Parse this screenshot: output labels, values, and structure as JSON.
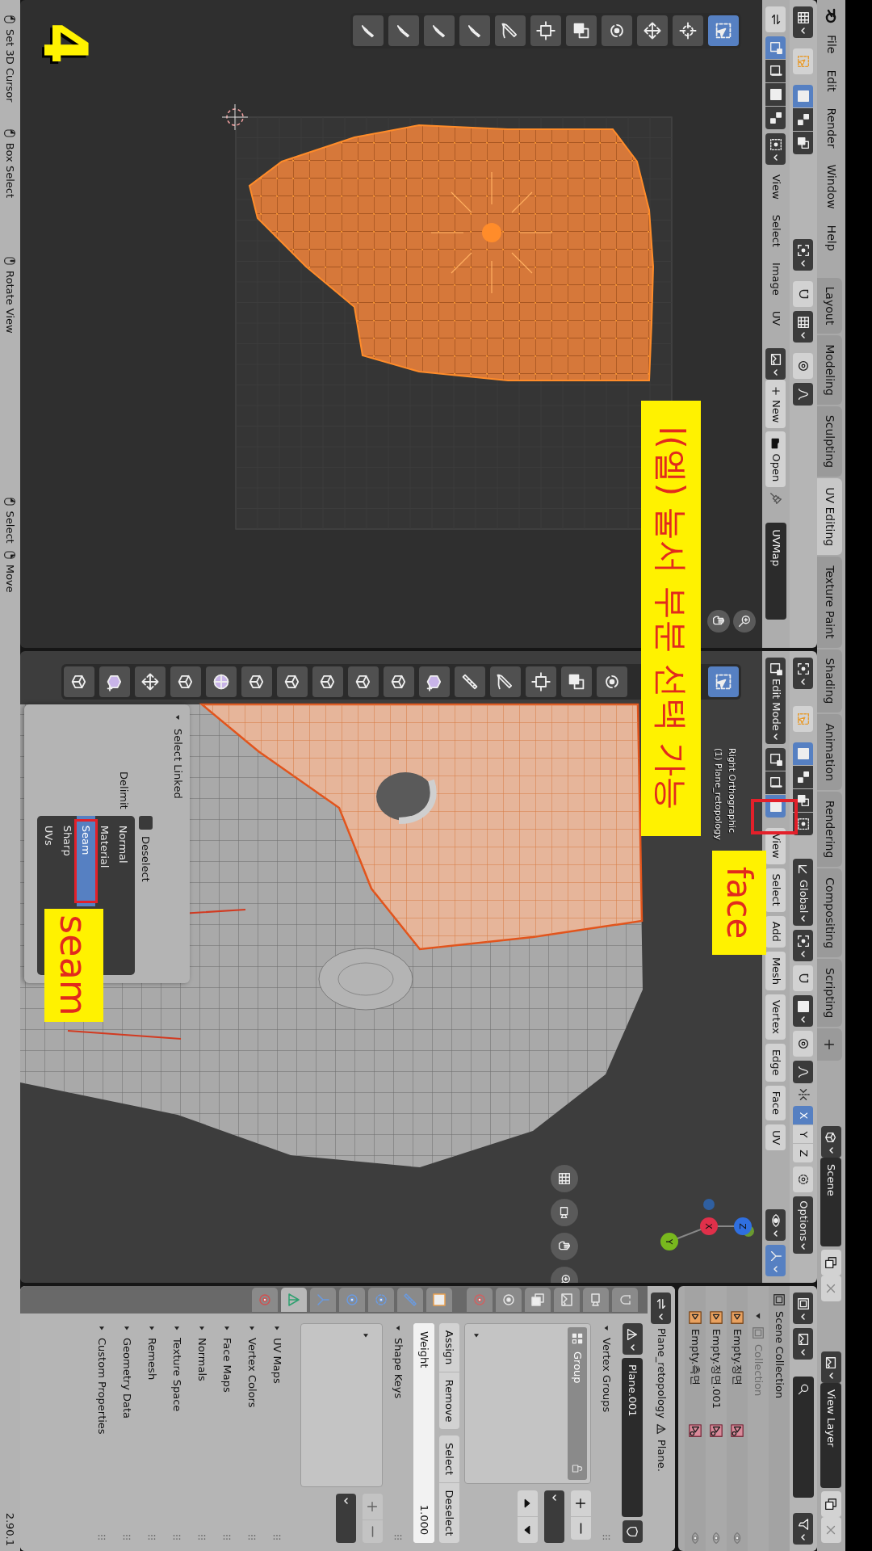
{
  "top_bar": {
    "menus": [
      "File",
      "Edit",
      "Render",
      "Window",
      "Help"
    ],
    "workspaces": [
      {
        "label": "Layout",
        "selected": false
      },
      {
        "label": "Modeling",
        "selected": false
      },
      {
        "label": "Sculpting",
        "selected": false
      },
      {
        "label": "UV Editing",
        "selected": true
      },
      {
        "label": "Texture Paint",
        "selected": false
      },
      {
        "label": "Shading",
        "selected": false
      },
      {
        "label": "Animation",
        "selected": false
      },
      {
        "label": "Rendering",
        "selected": false
      },
      {
        "label": "Compositing",
        "selected": false
      },
      {
        "label": "Scripting",
        "selected": false
      }
    ],
    "scene": "Scene",
    "view_layer": "View Layer"
  },
  "uv_editor": {
    "select_modes": [
      {
        "kind": "vertex",
        "selected": true
      },
      {
        "kind": "edge",
        "selected": false
      },
      {
        "kind": "face",
        "selected": false
      },
      {
        "kind": "island",
        "selected": false
      }
    ],
    "menus": [
      "View",
      "Select",
      "Image",
      "UV"
    ],
    "new_button": "New",
    "open_button": "Open",
    "uv_map": "UVMap",
    "tools": [
      {
        "kind": "select_box",
        "selected": true
      },
      {
        "kind": "cursor",
        "selected": false
      },
      {
        "kind": "move",
        "selected": false
      },
      {
        "kind": "rotate",
        "selected": false
      },
      {
        "kind": "scale",
        "selected": false
      },
      {
        "kind": "transform",
        "selected": false
      },
      {
        "kind": "annotate",
        "selected": false
      },
      {
        "kind": "brush",
        "selected": false
      },
      {
        "kind": "brush",
        "selected": false
      },
      {
        "kind": "brush",
        "selected": false
      },
      {
        "kind": "brush",
        "selected": false
      }
    ]
  },
  "viewport": {
    "mode": "Edit Mode",
    "select_modes": [
      {
        "kind": "vertex",
        "selected": false
      },
      {
        "kind": "edge",
        "selected": false
      },
      {
        "kind": "face",
        "selected": true
      }
    ],
    "orientation": "Global",
    "mirror_axes": [
      {
        "label": "X",
        "selected": true
      },
      {
        "label": "Y",
        "selected": false
      },
      {
        "label": "Z",
        "selected": false
      }
    ],
    "options": "Options",
    "menus": [
      "View",
      "Select",
      "Add",
      "Mesh",
      "Vertex",
      "Edge",
      "Face",
      "UV"
    ],
    "view_name": "Right Orthographic",
    "object_info": "(1) Plane_retopology",
    "gizmo_axes": [
      "Z",
      "X",
      "Y"
    ],
    "tools": [
      {
        "kind": "select_box",
        "selected": true
      },
      {
        "kind": "rotate",
        "selected": false
      },
      {
        "kind": "scale",
        "selected": false
      },
      {
        "kind": "transform",
        "selected": false
      },
      {
        "kind": "annotate",
        "selected": false
      },
      {
        "kind": "measure",
        "selected": false
      },
      {
        "kind": "add_cube",
        "selected": false
      },
      {
        "kind": "cube",
        "selected": false
      },
      {
        "kind": "cube",
        "selected": false
      },
      {
        "kind": "cube",
        "selected": false
      },
      {
        "kind": "cube",
        "selected": false
      },
      {
        "kind": "cube",
        "selected": false
      },
      {
        "kind": "sphere",
        "selected": false
      },
      {
        "kind": "cube",
        "selected": false
      },
      {
        "kind": "move",
        "selected": false
      },
      {
        "kind": "add_cube",
        "selected": false
      },
      {
        "kind": "cube",
        "selected": false
      }
    ],
    "operator_panel": {
      "title": "Select Linked",
      "deselect": {
        "label": "Deselect",
        "checked": false
      },
      "delimit_label": "Delimit",
      "delimit": [
        {
          "label": "Normal",
          "selected": false
        },
        {
          "label": "Material",
          "selected": false
        },
        {
          "label": "Seam",
          "selected": true
        },
        {
          "label": "Sharp",
          "selected": false
        },
        {
          "label": "UVs",
          "selected": false
        }
      ]
    }
  },
  "annotations": {
    "step": "4",
    "callouts": [
      "l(엘) 눌서 부분 선택 가능",
      "face",
      "seam"
    ]
  },
  "outliner": {
    "root": {
      "label": "Scene Collection",
      "dimmed": false,
      "children": [
        {
          "label": "Collection",
          "dimmed": true
        },
        {
          "label": "Empty.정면",
          "dimmed": false
        },
        {
          "label": "Empty.정면.001",
          "dimmed": false
        },
        {
          "label": "Empty.측면",
          "dimmed": false
        }
      ]
    }
  },
  "properties": {
    "tabs": [
      {
        "kind": "tool",
        "selected": false
      },
      {
        "kind": "render",
        "selected": false
      },
      {
        "kind": "output",
        "selected": false
      },
      {
        "kind": "view_layer",
        "selected": false
      },
      {
        "kind": "scene",
        "selected": false
      },
      {
        "kind": "world",
        "selected": false
      },
      {
        "kind": "object",
        "selected": false
      },
      {
        "kind": "modifiers",
        "selected": false
      },
      {
        "kind": "particles",
        "selected": false
      },
      {
        "kind": "physics",
        "selected": false
      },
      {
        "kind": "constraints",
        "selected": false
      },
      {
        "kind": "data",
        "selected": true
      },
      {
        "kind": "material",
        "selected": false
      }
    ],
    "breadcrumb": [
      "Plane_retopology",
      "Plane."
    ],
    "mesh_name": "Plane.001",
    "vertex_groups": {
      "title": "Vertex Groups",
      "items": [
        {
          "label": "Group",
          "selected": true
        }
      ],
      "buttons": [
        "Assign",
        "Remove",
        "Select",
        "Deselect"
      ],
      "weight_label": "Weight",
      "weight_value": "1.000",
      "level": 1
    },
    "shape_keys": {
      "title": "Shape Keys"
    },
    "collapsed_panels": [
      "UV Maps",
      "Vertex Colors",
      "Face Maps",
      "Normals",
      "Texture Space",
      "Remesh",
      "Geometry Data",
      "Custom Properties"
    ]
  },
  "status_bar": {
    "hints": [
      "Set 3D Cursor",
      "Box Select",
      "Rotate View",
      "Select",
      "Move"
    ],
    "version": "2.90.1"
  }
}
